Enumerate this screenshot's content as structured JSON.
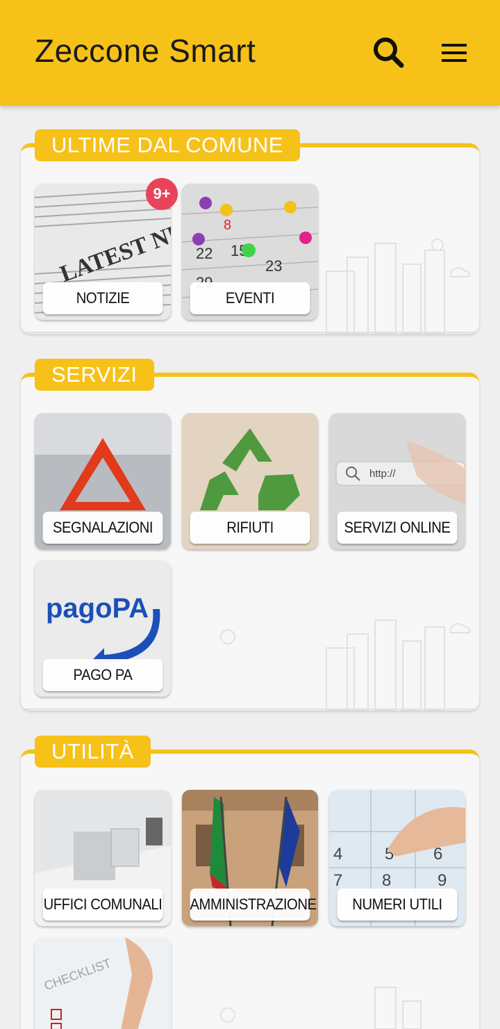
{
  "app": {
    "title": "Zeccone Smart"
  },
  "header": {
    "search_icon": "search-icon",
    "menu_icon": "hamburger-menu-icon"
  },
  "colors": {
    "accent": "#f6c119",
    "badge": "#e8435a",
    "background": "#efefef"
  },
  "sections": [
    {
      "title": "ULTIME DAL COMUNE",
      "tiles": [
        {
          "label": "NOTIZIE",
          "badge": "9+"
        },
        {
          "label": "EVENTI"
        }
      ]
    },
    {
      "title": "SERVIZI",
      "tiles": [
        {
          "label": "SEGNALAZIONI"
        },
        {
          "label": "RIFIUTI"
        },
        {
          "label": "SERVIZI ONLINE",
          "image_text": "http://"
        },
        {
          "label": "PAGO PA",
          "image_text": "pagoPA"
        }
      ]
    },
    {
      "title": "UTILITÀ",
      "tiles": [
        {
          "label": "UFFICI COMUNALI"
        },
        {
          "label": "AMMINISTRAZIONE"
        },
        {
          "label": "NUMERI UTILI"
        },
        {
          "label": "",
          "image_text": "CHECKLIST"
        }
      ]
    }
  ]
}
